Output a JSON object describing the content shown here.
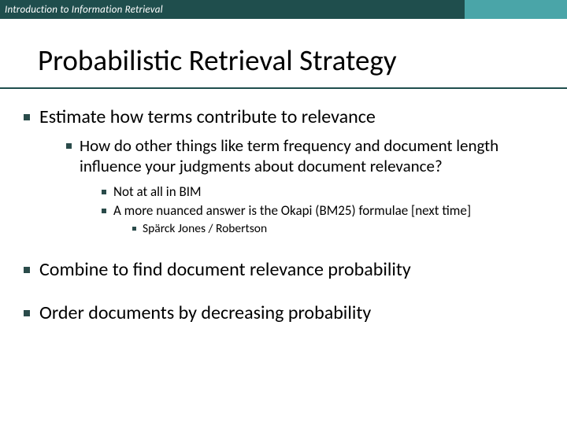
{
  "header": {
    "text": "Introduction to Information Retrieval"
  },
  "title": "Probabilistic Retrieval Strategy",
  "bullets": {
    "b1": "Estimate how terms contribute to relevance",
    "b1_1": "How do other things like term frequency and document length influence your judgments about document relevance?",
    "b1_1_1": "Not at all in BIM",
    "b1_1_2": "A more nuanced answer is the Okapi (BM25) formulae [next time]",
    "b1_1_2_1": "Spärck Jones / Robertson",
    "b2": "Combine to find document relevance probability",
    "b3": "Order documents by decreasing probability"
  }
}
